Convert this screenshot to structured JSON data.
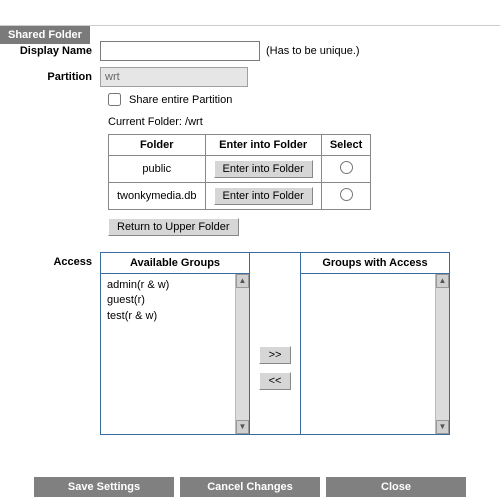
{
  "tab": {
    "title": "Shared Folder"
  },
  "display_name": {
    "label": "Display Name",
    "value": "",
    "hint": "(Has to be unique.)"
  },
  "partition": {
    "label": "Partition",
    "value": "wrt"
  },
  "share_entire": {
    "label": "Share entire Partition",
    "checked": false
  },
  "current_folder": {
    "prefix": "Current Folder: ",
    "path": "/wrt"
  },
  "folder_table": {
    "headers": {
      "folder": "Folder",
      "enter": "Enter into Folder",
      "select": "Select"
    },
    "rows": [
      {
        "name": "public",
        "button": "Enter into Folder"
      },
      {
        "name": "twonkymedia.db",
        "button": "Enter into Folder"
      }
    ],
    "return_label": "Return to Upper Folder"
  },
  "access": {
    "label": "Access",
    "available_title": "Available Groups",
    "with_access_title": "Groups with Access",
    "available_items": [
      "admin(r & w)",
      "guest(r)",
      "test(r & w)"
    ],
    "move_right": ">>",
    "move_left": "<<"
  },
  "buttons": {
    "save": "Save Settings",
    "cancel": "Cancel Changes",
    "close": "Close"
  }
}
